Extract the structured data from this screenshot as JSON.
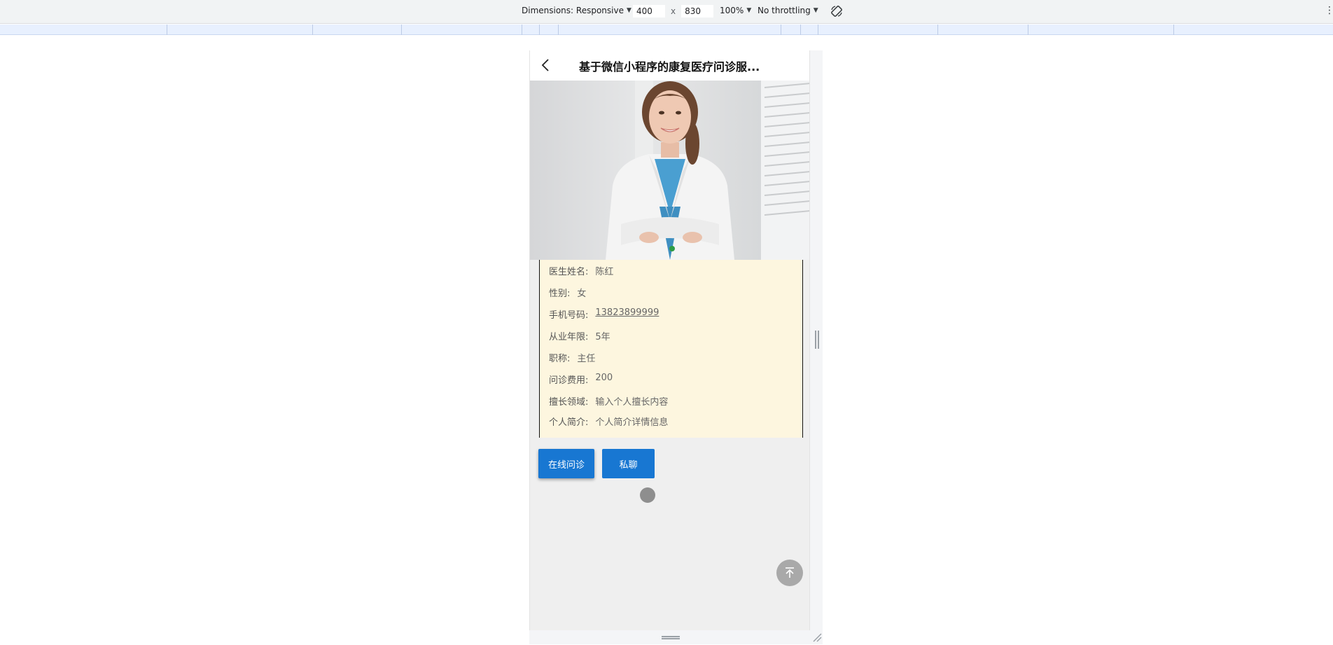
{
  "devtools": {
    "dimensions_label": "Dimensions: Responsive",
    "width_value": "400",
    "height_value": "830",
    "times": "x",
    "zoom": "100%",
    "throttling": "No throttling",
    "rotate_icon": "rotate-icon",
    "more_icon": "kebab-icon"
  },
  "app": {
    "title": "基于微信小程序的康复医疗问诊服...",
    "back_icon": "chevron-left-icon",
    "photo_alt": "doctor-photo",
    "fields": [
      {
        "label": "医生姓名:",
        "value": "陈红"
      },
      {
        "label": "性别:",
        "value": "女"
      },
      {
        "label": "手机号码:",
        "value": "13823899999"
      },
      {
        "label": "从业年限:",
        "value": "5年"
      },
      {
        "label": "职称:",
        "value": "主任"
      },
      {
        "label": "问诊费用:",
        "value": "200"
      },
      {
        "label": "擅长领域:",
        "value": "输入个人擅长内容"
      },
      {
        "label": "个人简介:",
        "value": "个人简介详情信息"
      }
    ],
    "buttons": {
      "consult": "在线问诊",
      "chat": "私聊"
    },
    "backtop_icon": "arrow-up-to-top-icon"
  },
  "colors": {
    "primary_button": "#1877d2",
    "card_bg": "#fdf6df",
    "page_bg": "#efefef",
    "dot": "#2e9c46"
  }
}
